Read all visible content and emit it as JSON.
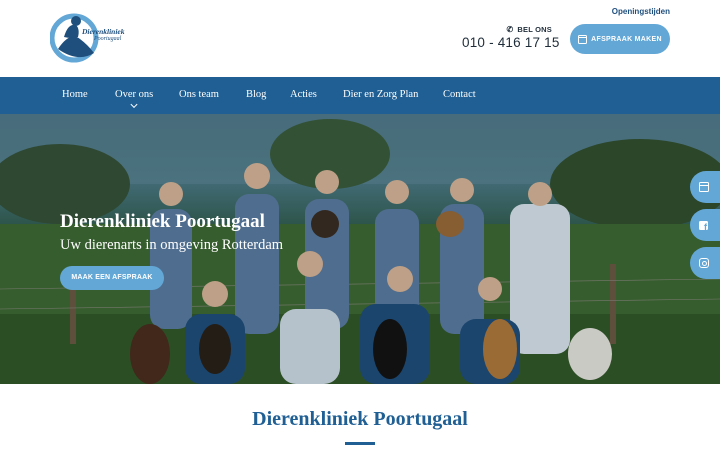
{
  "header": {
    "logo": {
      "name": "Dierenkliniek",
      "sub": "Poortugaal"
    },
    "hours_link": "Openingstijden",
    "call_label": "BEL ONS",
    "phone": "010 - 416 17 15",
    "appointment_button": "AFSPRAAK MAKEN",
    "icons": {
      "phone": "phone-icon",
      "calendar": "calendar-icon"
    }
  },
  "nav": {
    "items": [
      {
        "label": "Home"
      },
      {
        "label": "Over ons",
        "has_dropdown": true
      },
      {
        "label": "Ons team"
      },
      {
        "label": "Blog"
      },
      {
        "label": "Acties"
      },
      {
        "label": "Dier en Zorg Plan"
      },
      {
        "label": "Contact"
      }
    ]
  },
  "hero": {
    "title": "Dierenkliniek Poortugaal",
    "subtitle": "Uw dierenarts in omgeving Rotterdam",
    "button": "MAAK EEN AFSPRAAK",
    "image": "team photo with dogs in a green field",
    "side_buttons": [
      "calendar-icon",
      "facebook-icon",
      "instagram-icon"
    ]
  },
  "section": {
    "title": "Dierenkliniek Poortugaal"
  },
  "colors": {
    "nav_bg": "#1f5f94",
    "accent": "#63a7d6",
    "heading": "#1f5f94",
    "text_dark": "#1f2d3a"
  }
}
